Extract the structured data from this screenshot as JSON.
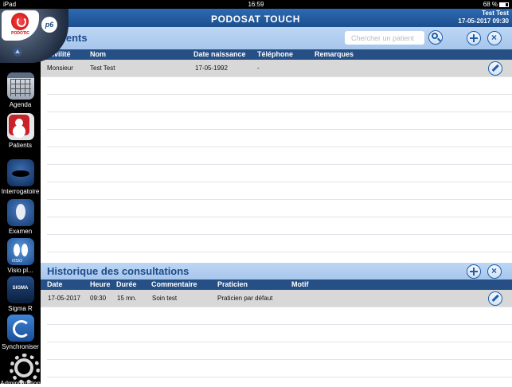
{
  "status": {
    "carrier": "iPad",
    "time": "16:59",
    "battery": "68 %"
  },
  "header": {
    "app_title": "PODOSAT TOUCH",
    "user_name": "Test Test",
    "datetime": "17-05-2017 09:30"
  },
  "logo": {
    "brand_small": "PODOTIC",
    "badge": "p6"
  },
  "sidebar": {
    "items": [
      {
        "label": "Agenda",
        "icon": "calendar-icon"
      },
      {
        "label": "Patients",
        "icon": "patient-icon"
      },
      {
        "label": "Interrogatoire",
        "icon": "interrogatoire-icon"
      },
      {
        "label": "Examen",
        "icon": "examen-icon"
      },
      {
        "label": "Visio pl...",
        "icon": "visio-icon",
        "icon_text": "VISIO"
      },
      {
        "label": "Sigma R",
        "icon": "sigma-icon",
        "icon_text": "SIGMA"
      },
      {
        "label": "Synchroniser",
        "icon": "sync-icon"
      },
      {
        "label": "Administration",
        "icon": "gear-icon"
      }
    ]
  },
  "patients": {
    "title": "Patients",
    "search_placeholder": "Chercher un patient",
    "columns": {
      "civilite": "Civilité",
      "nom": "Nom",
      "date_naissance": "Date naissance",
      "telephone": "Téléphone",
      "remarques": "Remarques"
    },
    "row": {
      "civilite": "Monsieur",
      "nom": "Test Test",
      "date_naissance": "17-05-1992",
      "telephone": "-",
      "remarques": ""
    }
  },
  "consultations": {
    "title": "Historique des consultations",
    "columns": {
      "date": "Date",
      "heure": "Heure",
      "duree": "Durée",
      "commentaire": "Commentaire",
      "praticien": "Praticien",
      "motif": "Motif"
    },
    "row": {
      "date": "17-05-2017",
      "heure": "09:30",
      "duree": "15 mn.",
      "commentaire": "Soin test",
      "praticien": "Praticien  par défaut",
      "motif": ""
    }
  },
  "colors": {
    "brand_blue": "#2c6ab4",
    "section_bg": "#bdd6f4",
    "header_row": "#264f86"
  }
}
